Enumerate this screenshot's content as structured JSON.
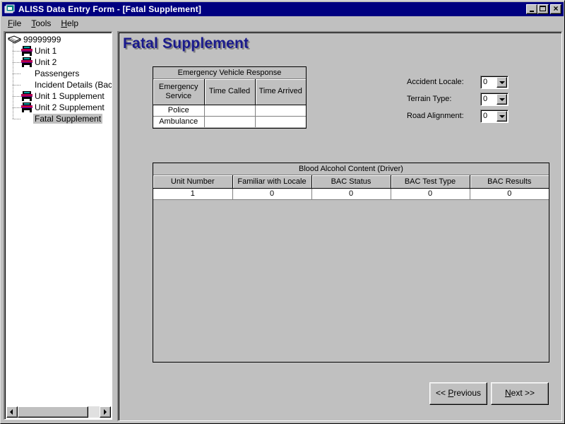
{
  "window": {
    "title": "ALISS Data Entry Form - [Fatal Supplement]",
    "buttons": {
      "minimize": "_",
      "maximize": "□",
      "close": "×"
    }
  },
  "menu": [
    {
      "label": "File",
      "accel": "F",
      "rest": "ile"
    },
    {
      "label": "Tools",
      "accel": "T",
      "rest": "ools"
    },
    {
      "label": "Help",
      "accel": "H",
      "rest": "elp"
    }
  ],
  "tree": {
    "root": {
      "label": "99999999",
      "icon": "book-icon"
    },
    "items": [
      {
        "label": "Unit 1",
        "icon": "car-icon"
      },
      {
        "label": "Unit 2",
        "icon": "car-icon"
      },
      {
        "label": "Passengers",
        "icon": ""
      },
      {
        "label": "Incident Details (BackF",
        "icon": ""
      },
      {
        "label": "Unit 1 Supplement",
        "icon": "car-icon"
      },
      {
        "label": "Unit 2 Supplement",
        "icon": "car-icon"
      },
      {
        "label": "Fatal Supplement",
        "icon": "",
        "selected": true
      }
    ]
  },
  "main": {
    "title": "Fatal Supplement",
    "title_color": "#1a1a8c",
    "emergency_grid": {
      "caption": "Emergency Vehicle Response",
      "columns": [
        "Emergency Service",
        "Time Called",
        "Time Arrived"
      ],
      "rows": [
        [
          "Police",
          "",
          ""
        ],
        [
          "Ambulance",
          "",
          ""
        ]
      ]
    },
    "fields": [
      {
        "label": "Accident Locale:",
        "value": "0"
      },
      {
        "label": "Terrain Type:",
        "value": "0"
      },
      {
        "label": "Road Alignment:",
        "value": "0"
      }
    ],
    "bac_grid": {
      "caption": "Blood Alcohol Content (Driver)",
      "columns": [
        "Unit Number",
        "Familiar with Locale",
        "BAC Status",
        "BAC Test Type",
        "BAC Results"
      ],
      "rows": [
        [
          "1",
          "0",
          "0",
          "0",
          "0"
        ]
      ]
    },
    "buttons": {
      "previous": {
        "pre": "<< ",
        "accel": "P",
        "rest": "revious"
      },
      "next": {
        "pre": "",
        "accel": "N",
        "rest": "ext >>"
      }
    }
  }
}
